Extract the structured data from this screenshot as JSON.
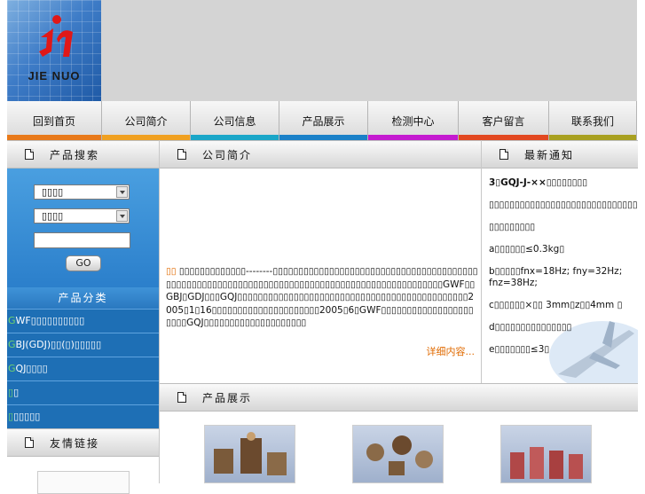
{
  "header": {
    "logo_text": "JIE NUO"
  },
  "nav": {
    "items": [
      {
        "label": "回到首页",
        "bar": "#e8791a"
      },
      {
        "label": "公司简介",
        "bar": "#f0a020"
      },
      {
        "label": "公司信息",
        "bar": "#1aa6c8"
      },
      {
        "label": "产品展示",
        "bar": "#1a80c8"
      },
      {
        "label": "检测中心",
        "bar": "#c41ad0"
      },
      {
        "label": "客户留言",
        "bar": "#e24820"
      },
      {
        "label": "联系我们",
        "bar": "#a8a020"
      }
    ]
  },
  "sidebar": {
    "search_title": "产品搜索",
    "select1_value": "▯▯▯▯",
    "select2_value": "▯▯▯▯",
    "go_label": "GO",
    "category_title": "产品分类",
    "categories": [
      {
        "prefix": "G",
        "rest": "WF▯▯▯▯▯▯▯▯▯▯"
      },
      {
        "prefix": "G",
        "rest": "BJ(GDJ)▯▯(▯)▯▯▯▯▯"
      },
      {
        "prefix": "G",
        "rest": "QJ▯▯▯▯"
      },
      {
        "prefix": "▯",
        "rest": "▯"
      },
      {
        "prefix": "▯",
        "rest": "▯▯▯▯▯"
      }
    ],
    "links_title": "友情链接"
  },
  "main": {
    "intro_title": "公司简介",
    "intro_highlight": "▯▯",
    "intro_text": " ▯▯▯▯▯▯▯▯▯▯▯▯▯--------▯▯▯▯▯▯▯▯▯▯▯▯▯▯▯▯▯▯▯▯▯▯▯▯▯▯▯▯▯▯▯▯▯▯▯▯▯▯▯▯▯▯▯▯▯▯▯▯▯▯▯▯▯▯▯▯▯▯▯▯▯▯▯▯▯▯▯▯▯▯▯▯▯▯▯▯▯▯▯▯▯▯▯▯▯▯▯▯▯▯▯▯▯▯GWF▯▯GBJ▯GDJ▯▯▯GQJ▯▯▯▯▯▯▯▯▯▯▯▯▯▯▯▯▯▯▯▯▯▯▯▯▯▯▯▯▯▯▯▯▯▯▯▯▯▯▯▯▯▯▯▯▯2005▯1▯16▯▯▯▯▯▯▯▯▯▯▯▯▯▯▯▯▯▯▯▯▯2005▯6▯GWF▯▯▯▯▯▯▯▯▯▯▯▯▯▯▯▯▯▯▯▯▯▯GQJ▯▯▯▯▯▯▯▯▯▯▯▯▯▯▯▯▯▯▯▯",
    "more_label": "详细内容...",
    "products_title": "产品展示"
  },
  "news": {
    "title": "最新通知",
    "lines": [
      "3▯GQJ-J-××▯▯▯▯▯▯▯▯",
      "▯▯▯▯▯▯▯▯▯▯▯▯▯▯▯▯▯▯▯▯▯▯▯▯▯▯▯▯▯▯▯▯▯▯▯",
      "▯▯▯▯▯▯▯▯▯",
      "a▯▯▯▯▯▯≤0.3kg▯",
      "b▯▯▯▯▯fnx=18Hz; fny=32Hz; fnz=38Hz;",
      "c▯▯▯▯▯▯×▯▯ 3mm▯z▯▯4mm ▯",
      "d▯▯▯▯▯▯▯▯▯▯▯▯▯▯▯",
      " e▯▯▯▯▯▯▯≤3▯"
    ]
  },
  "colors": {
    "nav_gradient_top": "#f7f7f7",
    "search_blue": "#2b7fcb",
    "accent_orange": "#e06a00"
  }
}
